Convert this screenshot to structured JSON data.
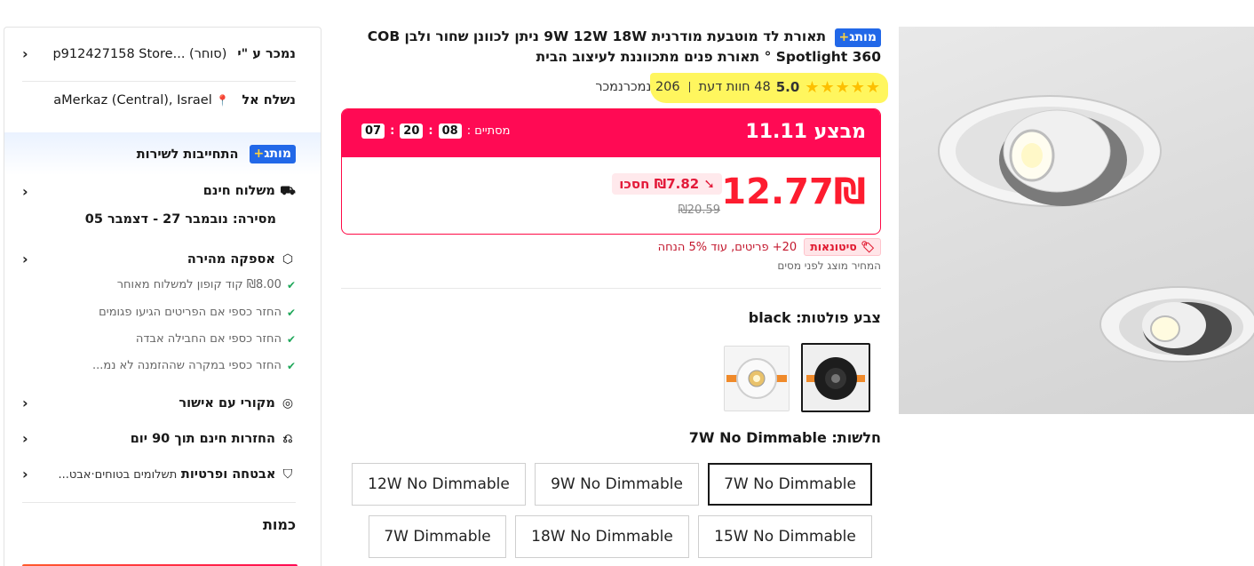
{
  "product": {
    "badge_word": "מותג",
    "badge_plus": "+",
    "title": "תאורת לד מוטבעת מודרנית 9W 12W 18W ניתן לכוונן שחור ולבן COB Spotlight 360 ° תאורת פנים מתכווננת לעיצוב הבית",
    "rating": "5.0",
    "stars": "★★★★★",
    "reviews": "48 חוות דעת",
    "sold": "206 נמכרנמכר"
  },
  "deal": {
    "title": "מבצע 11.11",
    "ends_label": "מסתיים :",
    "hours": "08",
    "minutes": "20",
    "seconds": "07",
    "price": "12.77₪",
    "save": "₪7.82 חסכו",
    "old_price": "₪20.59"
  },
  "tiers": {
    "tag": "סיטונאות",
    "text": "20+ פריטים, עוד 5% הנחה",
    "tax_note": "המחיר מוצג לפני מסים"
  },
  "color": {
    "label": "צבע פולטות: black"
  },
  "power": {
    "label": "חלשות: 7W No Dimmable",
    "options": [
      "7W No Dimmable",
      "9W No Dimmable",
      "12W No Dimmable",
      "15W No Dimmable",
      "18W No Dimmable",
      "7W Dimmable"
    ]
  },
  "sidebar": {
    "seller_label": "נמכר ע \"י",
    "seller_value": "p912427158 Store...  (סוחר)",
    "ship_label": "נשלח אל",
    "ship_value": "aMerkaz (Central), Israel",
    "plus_badge": "מותג",
    "plus_text": "התחייבות לשירות",
    "free_ship": "משלוח חינם",
    "delivery": "מסירה: נובמבר 27 - דצמבר 05",
    "fast": "אספקה מהירה",
    "fast_items": [
      "₪8.00 קוד קופון למשלוח מאוחר",
      "החזר כספי אם הפריטים הגיעו פגומים",
      "החזר כספי אם החבילה אבדה",
      "החזר כספי במקרה שההזמנה לא נמ..."
    ],
    "original": "מקורי עם אישור",
    "returns": "החזרות חינם תוך 90 יום",
    "security": "אבטחה ופרטיות",
    "security_sub": "תשלומים בטוחים·אבט...",
    "quantity": "כמות"
  },
  "icons": {
    "pin": "📍",
    "truck": "⛟",
    "box": "⬡",
    "shield_check": "⛉",
    "return": "⎌"
  },
  "colors": {
    "accent": "#ff0a54",
    "price": "#fd1c2f",
    "plus_blue": "#2268e8"
  }
}
